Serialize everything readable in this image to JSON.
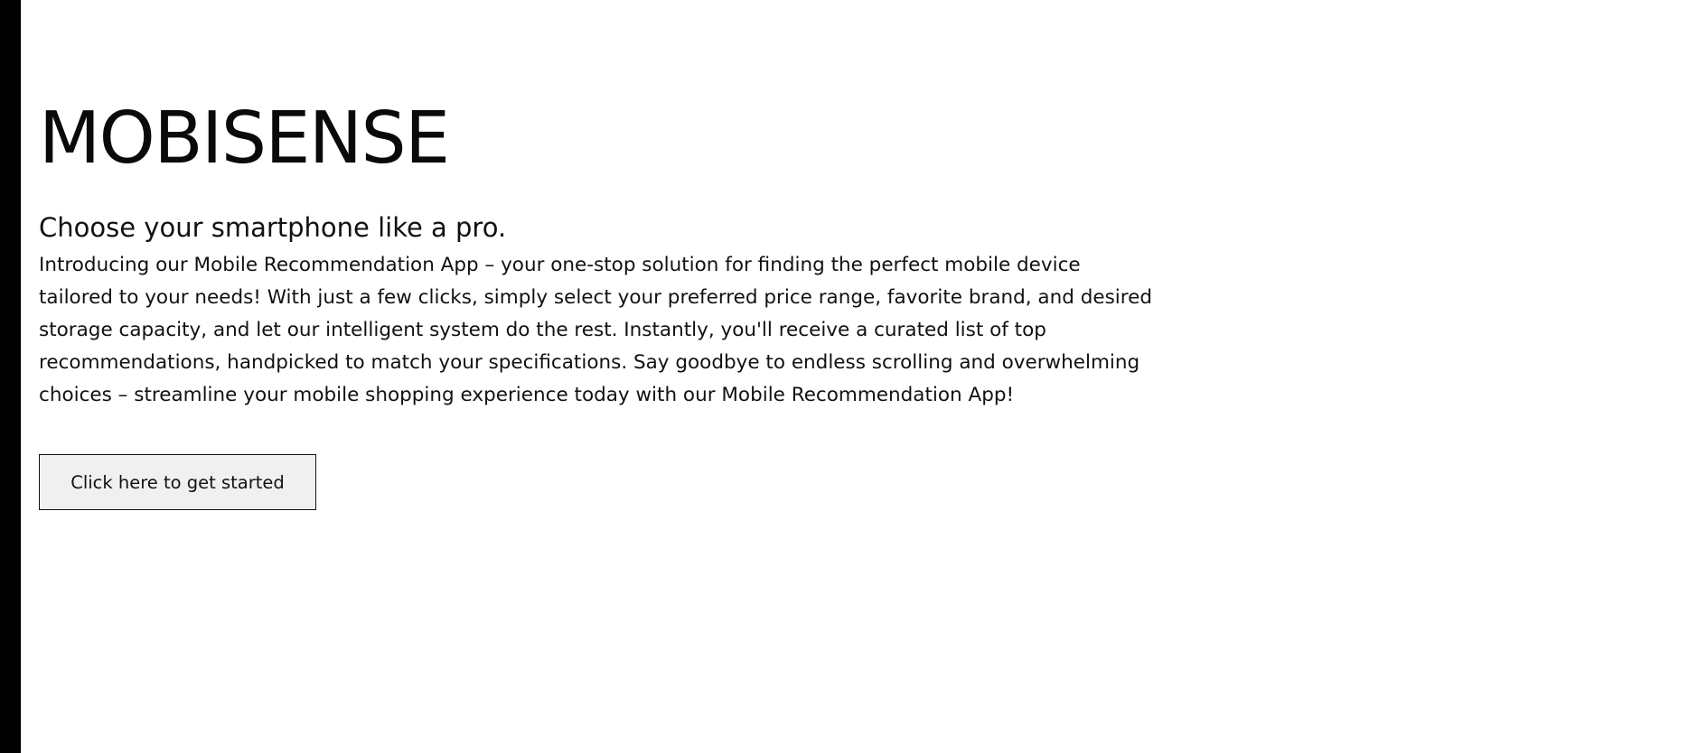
{
  "hero": {
    "title": "MOBISENSE",
    "tagline": "Choose your smartphone like a pro.",
    "description": "Introducing our Mobile Recommendation App – your one-stop solution for finding the perfect mobile device tailored to your needs! With just a few clicks, simply select your preferred price range, favorite brand, and desired storage capacity, and let our intelligent system do the rest. Instantly, you'll receive a curated list of top recommendations, handpicked to match your specifications. Say goodbye to endless scrolling and overwhelming choices – streamline your mobile shopping experience today with our Mobile Recommendation App!",
    "cta_label": "Click here to get started"
  },
  "colors": {
    "side_bar": "#000000",
    "background": "#ffffff",
    "button_background": "#f0f0f0",
    "text": "#111111"
  }
}
